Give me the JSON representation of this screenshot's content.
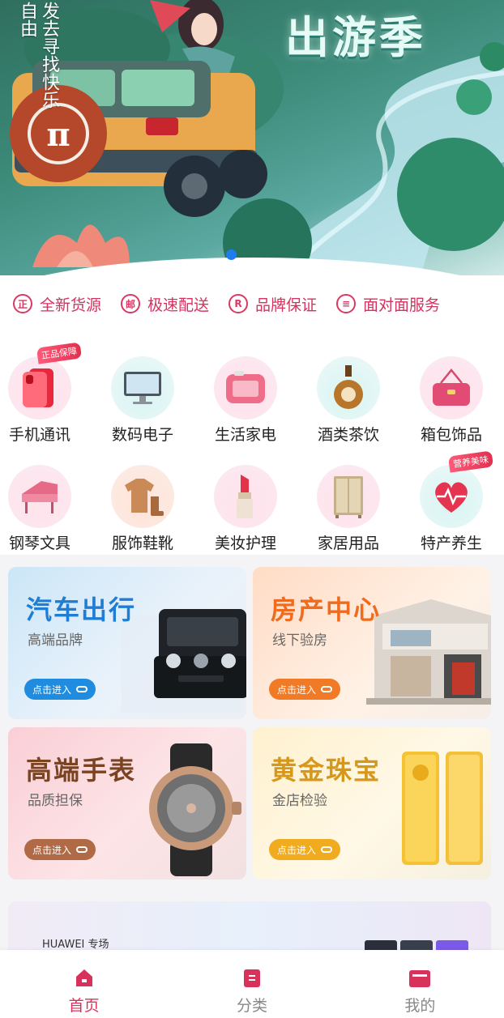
{
  "banner": {
    "title": "出游季",
    "side_text": "发去寻找快乐自由",
    "logo_glyph": "π",
    "indicator_count": 1
  },
  "features": [
    {
      "icon": "certified-icon",
      "glyph": "正",
      "label": "全新货源"
    },
    {
      "icon": "post-icon",
      "glyph": "邮",
      "label": "极速配送"
    },
    {
      "icon": "registered-icon",
      "glyph": "R",
      "label": "品牌保证"
    },
    {
      "icon": "face-service-icon",
      "glyph": "≡",
      "label": "面对面服务"
    }
  ],
  "categories": [
    {
      "label": "手机通讯",
      "icon": "phone-icon",
      "badge": "正品保障"
    },
    {
      "label": "数码电子",
      "icon": "monitor-icon",
      "badge": ""
    },
    {
      "label": "生活家电",
      "icon": "toaster-icon",
      "badge": ""
    },
    {
      "label": "酒类茶饮",
      "icon": "liquor-bottle-icon",
      "badge": ""
    },
    {
      "label": "箱包饰品",
      "icon": "handbag-icon",
      "badge": ""
    },
    {
      "label": "钢琴文具",
      "icon": "piano-icon",
      "badge": ""
    },
    {
      "label": "服饰鞋靴",
      "icon": "sweater-boots-icon",
      "badge": ""
    },
    {
      "label": "美妆护理",
      "icon": "lipstick-icon",
      "badge": ""
    },
    {
      "label": "家居用品",
      "icon": "wardrobe-icon",
      "badge": ""
    },
    {
      "label": "特产养生",
      "icon": "heart-icon",
      "badge": "营养美味"
    }
  ],
  "promos": [
    {
      "title": "汽车出行",
      "subtitle": "高端品牌",
      "button": "点击进入",
      "title_color": "#1f7dd4",
      "button_color": "#1f8ce0"
    },
    {
      "title": "房产中心",
      "subtitle": "线下验房",
      "button": "点击进入",
      "title_color": "#f06b1e",
      "button_color": "#f07a25"
    },
    {
      "title": "高端手表",
      "subtitle": "品质担保",
      "button": "点击进入",
      "title_color": "#7a4322",
      "button_color": "#b06a45"
    },
    {
      "title": "黄金珠宝",
      "subtitle": "金店检验",
      "button": "点击进入",
      "title_color": "#d6981a",
      "button_color": "#f0ab1e"
    }
  ],
  "huawei": {
    "label": "HUAWEI 专场"
  },
  "nav": [
    {
      "label": "首页",
      "icon": "home-icon",
      "active": true
    },
    {
      "label": "分类",
      "icon": "category-icon",
      "active": false
    },
    {
      "label": "我的",
      "icon": "wallet-icon",
      "active": false
    }
  ],
  "colors": {
    "accent": "#d8325b",
    "feature": "#d2335f"
  }
}
